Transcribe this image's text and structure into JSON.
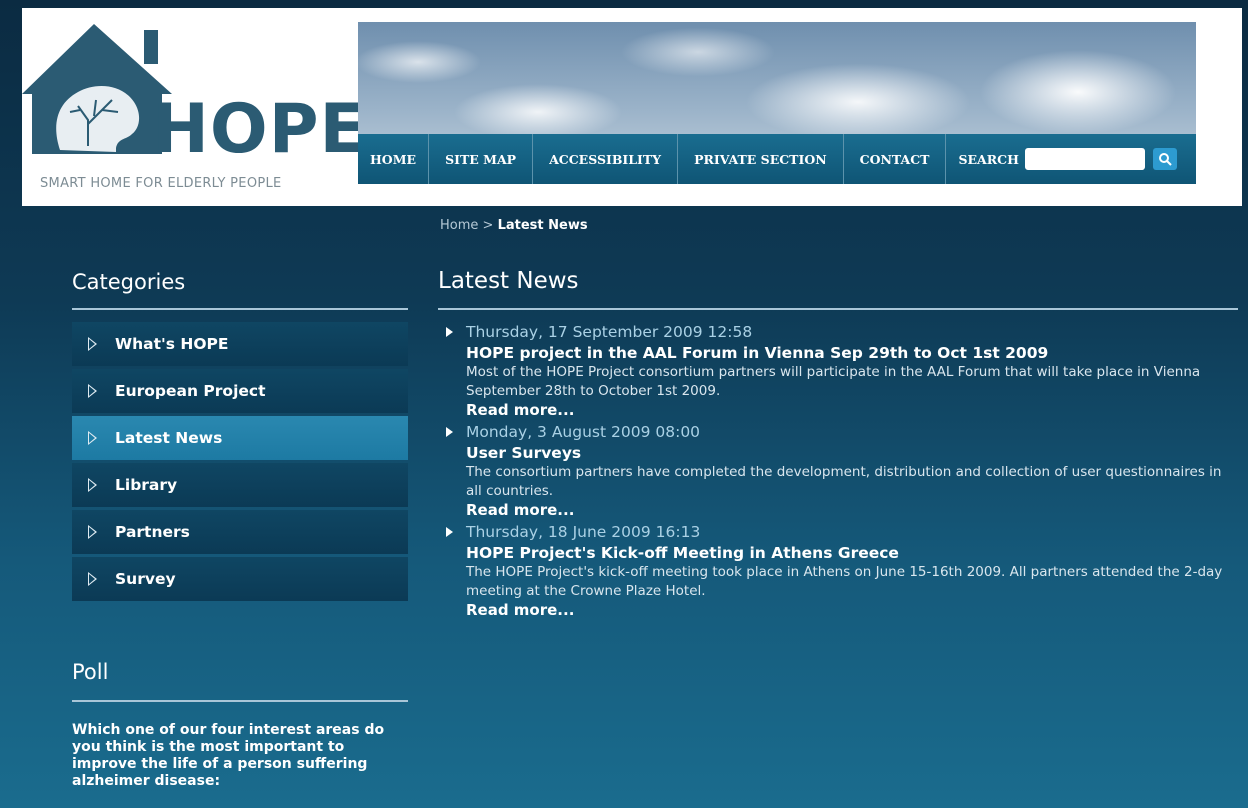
{
  "header": {
    "logo_text": "HOPE",
    "logo_tagline": "SMART HOME FOR ELDERLY PEOPLE"
  },
  "nav": {
    "items": [
      "HOME",
      "SITE MAP",
      "ACCESSIBILITY",
      "PRIVATE SECTION",
      "CONTACT"
    ],
    "search_label": "SEARCH",
    "search_value": ""
  },
  "breadcrumb": {
    "home": "Home",
    "separator": ">",
    "current": "Latest News"
  },
  "sidebar": {
    "categories_title": "Categories",
    "categories": [
      "What's HOPE",
      "European Project",
      "Latest News",
      "Library",
      "Partners",
      "Survey"
    ],
    "active_category": "Latest News",
    "poll_title": "Poll",
    "poll_question": "Which one of our four interest areas do you think is the most important to improve the life of a person suffering alzheimer disease:"
  },
  "main": {
    "title": "Latest News",
    "news": [
      {
        "date": "Thursday, 17 September 2009 12:58",
        "title": "HOPE project in the AAL Forum in Vienna Sep 29th to Oct 1st 2009",
        "body": "Most of the HOPE Project consortium partners will participate in the AAL Forum that will take place in Vienna September 28th to October 1st 2009.",
        "more": "Read more..."
      },
      {
        "date": "Monday, 3 August 2009 08:00",
        "title": "User Surveys",
        "body": "The consortium partners have completed the development, distribution and collection of user questionnaires in all countries.",
        "more": "Read more..."
      },
      {
        "date": "Thursday, 18 June 2009 16:13",
        "title": "HOPE Project's Kick-off Meeting in Athens Greece",
        "body": "The HOPE Project's kick-off meeting took place in Athens on June 15-16th 2009. All partners attended the 2-day meeting at the Crowne Plaze Hotel.",
        "more": "Read more..."
      }
    ]
  },
  "colors": {
    "header_bg": "#ffffff",
    "nav_bg": "#1a6d90",
    "page_bg_top": "#0b2b42",
    "page_bg_bottom": "#1a6c8e",
    "active_category": "#2a88b0",
    "date_color": "#aad1e5"
  },
  "icons": {
    "logo": "house-head-tree-icon",
    "search": "magnifier-icon",
    "category_bullet": "outline-triangle-icon",
    "news_bullet": "solid-triangle-icon"
  }
}
